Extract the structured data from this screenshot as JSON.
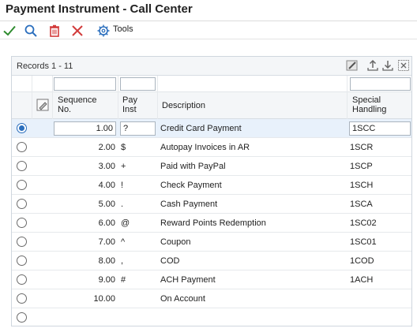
{
  "window": {
    "title": "Payment Instrument - Call Center"
  },
  "toolbar": {
    "ok_icon": "check-icon",
    "search_icon": "search-icon",
    "delete_icon": "delete-icon",
    "cancel_icon": "close-icon",
    "tools_icon": "gear-icon",
    "tools_label": "Tools",
    "colors": {
      "ok": "#2e8b2e",
      "search": "#2a6ebd",
      "delete": "#d23b3b",
      "cancel": "#d23b3b"
    }
  },
  "grid": {
    "records_label": "Records 1 - 11",
    "columns": {
      "sequence": "Sequence No.",
      "sequence_line1": "Sequence",
      "sequence_line2": "No.",
      "pay_inst": "Pay Inst",
      "pay_inst_line1": "Pay",
      "pay_inst_line2": "Inst",
      "description": "Description",
      "special_handling": "Special Handling",
      "special_line1": "Special",
      "special_line2": "Handling"
    },
    "filters": {
      "sequence": "",
      "pay_inst": "",
      "special_handling": ""
    },
    "rows": [
      {
        "selected": true,
        "sequence": "1.00",
        "pay_inst": "?",
        "description": "Credit Card Payment",
        "special": "1SCC"
      },
      {
        "selected": false,
        "sequence": "2.00",
        "pay_inst": "$",
        "description": "Autopay Invoices in AR",
        "special": "1SCR"
      },
      {
        "selected": false,
        "sequence": "3.00",
        "pay_inst": "+",
        "description": "Paid with PayPal",
        "special": "1SCP"
      },
      {
        "selected": false,
        "sequence": "4.00",
        "pay_inst": "!",
        "description": "Check Payment",
        "special": "1SCH"
      },
      {
        "selected": false,
        "sequence": "5.00",
        "pay_inst": ".",
        "description": "Cash Payment",
        "special": "1SCA"
      },
      {
        "selected": false,
        "sequence": "6.00",
        "pay_inst": "@",
        "description": "Reward Points Redemption",
        "special": "1SC02"
      },
      {
        "selected": false,
        "sequence": "7.00",
        "pay_inst": "^",
        "description": "Coupon",
        "special": "1SC01"
      },
      {
        "selected": false,
        "sequence": "8.00",
        "pay_inst": ",",
        "description": "COD",
        "special": "1COD"
      },
      {
        "selected": false,
        "sequence": "9.00",
        "pay_inst": "#",
        "description": "ACH Payment",
        "special": "1ACH"
      },
      {
        "selected": false,
        "sequence": "10.00",
        "pay_inst": "",
        "description": "On Account",
        "special": ""
      },
      {
        "selected": false,
        "sequence": "",
        "pay_inst": "",
        "description": "",
        "special": ""
      }
    ]
  }
}
